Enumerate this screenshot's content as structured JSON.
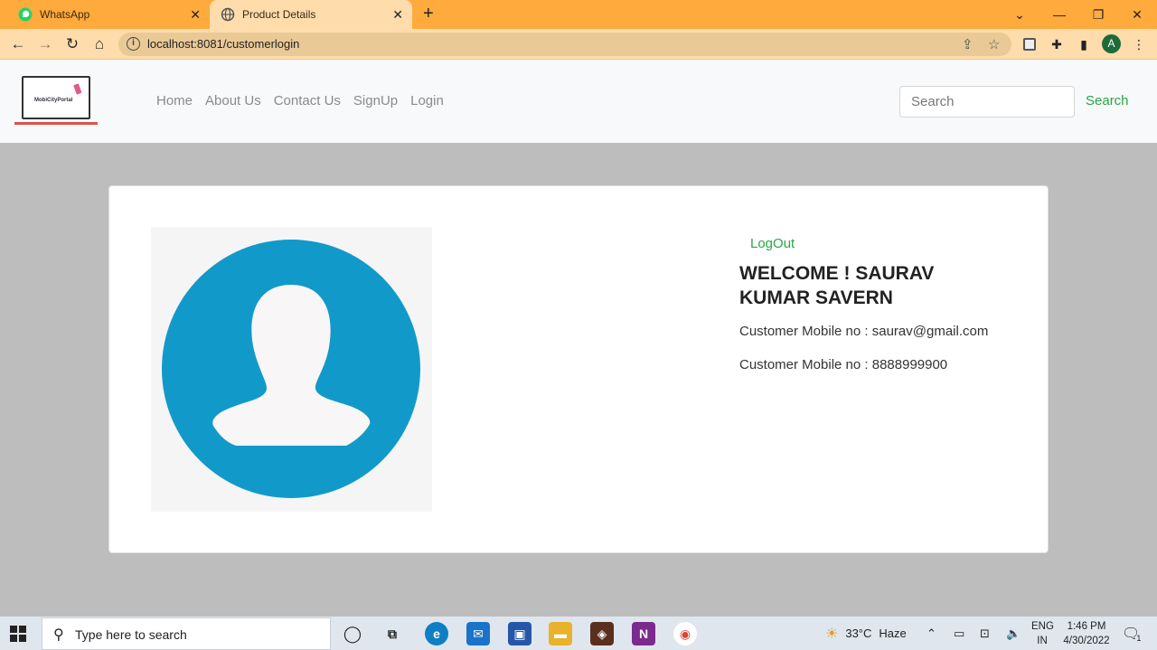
{
  "browser": {
    "tabs": [
      {
        "label": "WhatsApp",
        "icon": "whatsapp-icon"
      },
      {
        "label": "Product Details",
        "icon": "globe-icon"
      }
    ],
    "url": "localhost:8081/customerlogin",
    "profile_letter": "A"
  },
  "site": {
    "logo_text": "MobiCityPortal",
    "nav": [
      "Home",
      "About Us",
      "Contact Us",
      "SignUp",
      "Login"
    ],
    "search_placeholder": "Search",
    "search_button": "Search"
  },
  "profile": {
    "logout": "LogOut",
    "welcome": "WELCOME ! SAURAV KUMAR SAVERN",
    "email_line": "Customer Mobile no : saurav@gmail.com",
    "mobile_line": "Customer Mobile no : 8888999900"
  },
  "taskbar": {
    "search_placeholder": "Type here to search",
    "weather_temp": "33°C",
    "weather_desc": "Haze",
    "lang_line1": "ENG",
    "lang_line2": "IN",
    "time": "1:46 PM",
    "date": "4/30/2022",
    "notification_count": "1"
  },
  "colors": {
    "tab_strip": "#ffaa3c",
    "active_tab": "#ffdcab",
    "accent_green": "#28a745",
    "avatar_blue": "#119ac9",
    "page_bg": "#bdbdbd"
  }
}
